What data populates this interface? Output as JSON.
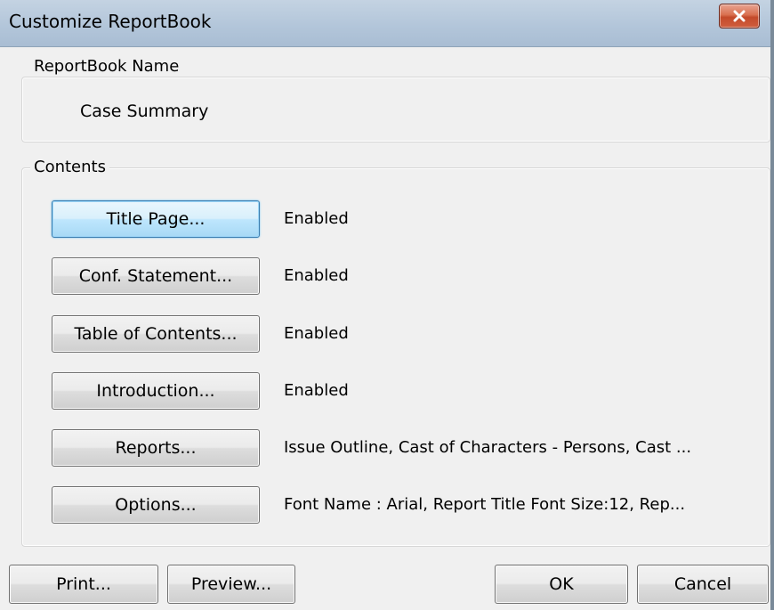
{
  "window": {
    "title": "Customize ReportBook",
    "close_label": "×"
  },
  "reportbook_name": {
    "group_label": "ReportBook Name",
    "value": "Case Summary"
  },
  "contents": {
    "group_label": "Contents",
    "rows": [
      {
        "button": "Title Page...",
        "status": "Enabled"
      },
      {
        "button": "Conf. Statement...",
        "status": "Enabled"
      },
      {
        "button": "Table of Contents...",
        "status": "Enabled"
      },
      {
        "button": "Introduction...",
        "status": "Enabled"
      },
      {
        "button": "Reports...",
        "status": "Issue Outline, Cast of Characters - Persons, Cast ..."
      },
      {
        "button": "Options...",
        "status": "Font Name : Arial, Report Title Font Size:12, Rep..."
      }
    ]
  },
  "footer": {
    "print": "Print...",
    "preview": "Preview...",
    "ok": "OK",
    "cancel": "Cancel"
  },
  "icons": {
    "close": "close-icon"
  }
}
